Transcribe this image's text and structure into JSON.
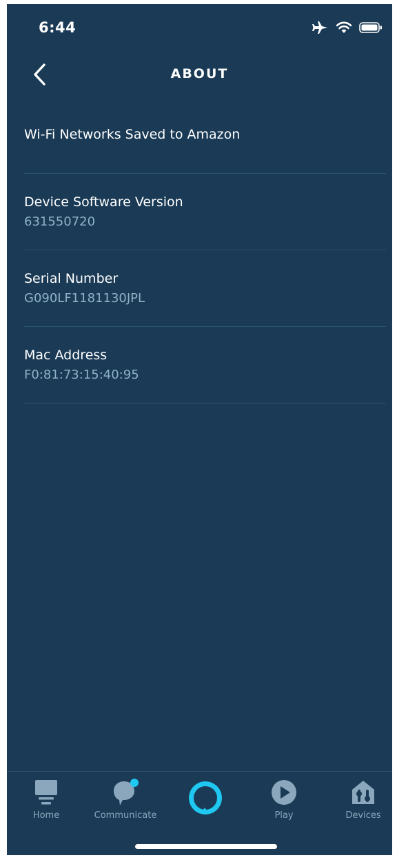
{
  "status_bar": {
    "time": "6:44",
    "icons": [
      "airplane-mode-icon",
      "wifi-icon",
      "battery-icon"
    ]
  },
  "header": {
    "title": "ABOUT",
    "back_icon": "chevron-left-icon"
  },
  "items": [
    {
      "title": "Wi-Fi Networks Saved to Amazon"
    },
    {
      "title": "Device Software Version",
      "value": "631550720"
    },
    {
      "title": "Serial Number",
      "value": "G090LF1181130JPL"
    },
    {
      "title": "Mac Address",
      "value": "F0:81:73:15:40:95"
    }
  ],
  "bottom_nav": {
    "home": {
      "label": "Home",
      "icon": "home-icon"
    },
    "communicate": {
      "label": "Communicate",
      "icon": "chat-bubble-icon",
      "has_notification": true
    },
    "alexa": {
      "icon": "alexa-ring-icon"
    },
    "play": {
      "label": "Play",
      "icon": "play-icon"
    },
    "devices": {
      "label": "Devices",
      "icon": "devices-icon"
    }
  },
  "colors": {
    "background": "#1a3a55",
    "value_text": "#8fb3c6",
    "nav_inactive": "#8aa7bd",
    "accent": "#1ec8f0"
  }
}
